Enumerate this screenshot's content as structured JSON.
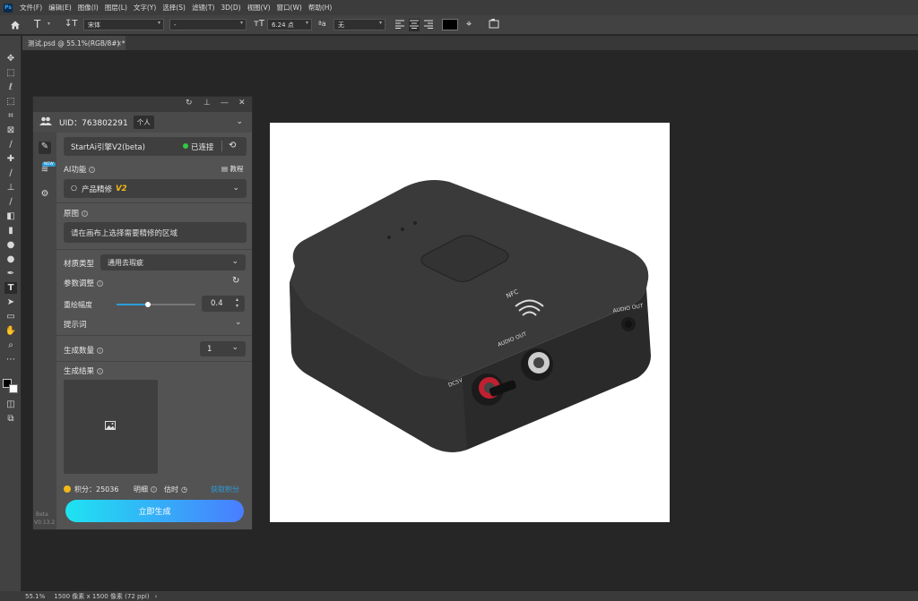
{
  "menubar": {
    "logo": "Ps",
    "items": [
      "文件(F)",
      "编辑(E)",
      "图像(I)",
      "图层(L)",
      "文字(Y)",
      "选择(S)",
      "滤镜(T)",
      "3D(D)",
      "视图(V)",
      "窗口(W)",
      "帮助(H)"
    ]
  },
  "options": {
    "font_family": "宋体",
    "font_style": "-",
    "font_size": "6.24 点",
    "antialias": "无"
  },
  "document": {
    "tab_title": "测试.psd @ 55.1%(RGB/8#) *"
  },
  "status": {
    "zoom": "55.1%",
    "info": "1500 像素 x 1500 像素 (72 ppi)"
  },
  "panel": {
    "uid_label": "UID：763802291",
    "account_type": "个人",
    "engine_name": "StartAi引擎V2(beta)",
    "connection_status": "已连接",
    "new_badge": "NEW",
    "ai_function_label": "AI功能",
    "tutorial_label": "教程",
    "function_name": "产品精修",
    "function_version": "V2",
    "original_label": "原图",
    "original_hint": "请在画布上选择需要精修的区域",
    "material_label": "材质类型",
    "material_value": "通用去瑕疵",
    "params_label": "参数调整",
    "redraw_label": "重绘幅度",
    "redraw_value": "0.4",
    "redraw_fraction": 0.4,
    "prompt_label": "提示词",
    "count_label": "生成数量",
    "count_value": "1",
    "result_label": "生成结果",
    "points_text": "积分：25036",
    "detail_label": "明细",
    "estimate_label": "估时",
    "get_points_label": "获取积分",
    "generate_button": "立即生成",
    "version_line1": "Beta",
    "version_line2": "V0.13.2"
  },
  "photo": {
    "nfc_label": "NFC",
    "audio_out_label": "AUDIO OUT",
    "audio_out_label_2": "AUDIO OUT",
    "dc_label": "DC5V"
  },
  "colors": {
    "accent_blue": "#2d9cdb",
    "status_green": "#2ecc40",
    "button_gradient_start": "#1ee3f0",
    "button_gradient_end": "#4a7dff",
    "points_gold": "#f2b818"
  }
}
